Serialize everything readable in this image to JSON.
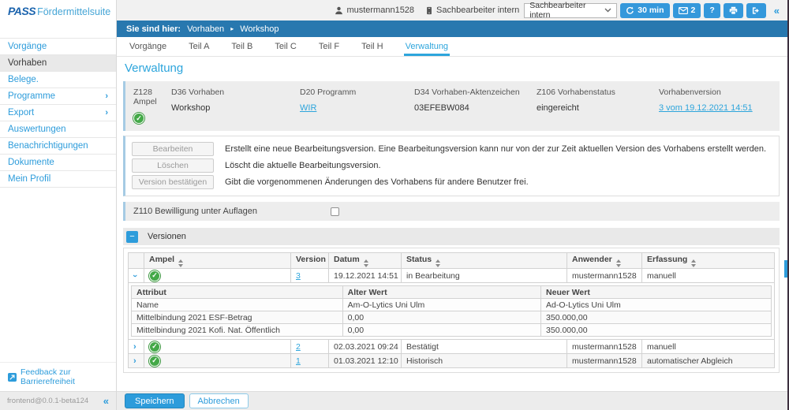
{
  "glyphs": {
    "check": "✓",
    "chevron_right": "›",
    "collapse_left": "«",
    "minus": "−",
    "breadcrumb_arrow": "▸"
  },
  "brand": {
    "bold": "PASS",
    "rest": "Fördermittelsuite"
  },
  "topbar": {
    "username": "mustermann1528",
    "role": "Sachbearbeiter intern",
    "role_select": "Sachbearbeiter intern",
    "session": "30 min",
    "mail_count": "2",
    "help": "?"
  },
  "sidebar": {
    "items": [
      {
        "label": "Vorgänge"
      },
      {
        "label": "Vorhaben"
      },
      {
        "label": "Belege."
      },
      {
        "label": "Programme"
      },
      {
        "label": "Export"
      },
      {
        "label": "Auswertungen"
      },
      {
        "label": "Benachrichtigungen"
      },
      {
        "label": "Dokumente"
      },
      {
        "label": "Mein Profil"
      }
    ],
    "feedback": "Feedback zur Barrierefreiheit",
    "build": "frontend@0.0.1-beta124"
  },
  "breadcrumb": {
    "prefix": "Sie sind hier:",
    "level1": "Vorhaben",
    "level2": "Workshop"
  },
  "tabs": {
    "items": [
      "Vorgänge",
      "Teil A",
      "Teil B",
      "Teil C",
      "Teil F",
      "Teil H",
      "Verwaltung"
    ]
  },
  "page": {
    "title": "Verwaltung"
  },
  "summary": {
    "fields": [
      {
        "label": "Z128 Ampel",
        "value": ""
      },
      {
        "label": "D36 Vorhaben",
        "value": "Workshop"
      },
      {
        "label": "D20 Programm",
        "value": "WIR"
      },
      {
        "label": "D34 Vorhaben-Aktenzeichen",
        "value": "03EFEBW084"
      },
      {
        "label": "Z106 Vorhabenstatus",
        "value": "eingereicht"
      },
      {
        "label": "Vorhabenversion",
        "value": "3 vom 19.12.2021 14:51"
      }
    ]
  },
  "actions": {
    "rows": [
      {
        "button": "Bearbeiten",
        "description": "Erstellt eine neue Bearbeitungsversion. Eine Bearbeitungsversion kann nur von der zur Zeit aktuellen Version des Vorhabens erstellt werden."
      },
      {
        "button": "Löschen",
        "description": "Löscht die aktuelle Bearbeitungsversion."
      },
      {
        "button": "Version bestätigen",
        "description": "Gibt die vorgenommenen Änderungen des Vorhabens für andere Benutzer frei."
      }
    ]
  },
  "approval": {
    "label": "Z110 Bewilligung unter Auflagen",
    "checked": false
  },
  "versions": {
    "title": "Versionen",
    "columns": {
      "ampel": "Ampel",
      "version": "Version",
      "datum": "Datum",
      "status": "Status",
      "anwender": "Anwender",
      "erfassung": "Erfassung"
    },
    "rows": [
      {
        "version": "3",
        "datum": "19.12.2021 14:51",
        "status": "in Bearbeitung",
        "anwender": "mustermann1528",
        "erfassung": "manuell"
      },
      {
        "version": "2",
        "datum": "02.03.2021 09:24",
        "status": "Bestätigt",
        "anwender": "mustermann1528",
        "erfassung": "manuell"
      },
      {
        "version": "1",
        "datum": "01.03.2021 12:10",
        "status": "Historisch",
        "anwender": "mustermann1528",
        "erfassung": "automatischer Abgleich"
      }
    ],
    "detail": {
      "columns": {
        "attribut": "Attribut",
        "alter": "Alter Wert",
        "neuer": "Neuer Wert"
      },
      "rows": [
        {
          "attribut": "Name",
          "alter": "Am-O-Lytics Uni Ulm",
          "neuer": "Ad-O-Lytics Uni Ulm"
        },
        {
          "attribut": "Mittelbindung 2021 ESF-Betrag",
          "alter": "0,00",
          "neuer": "350.000,00"
        },
        {
          "attribut": "Mittelbindung 2021 Kofi. Nat. Öffentlich",
          "alter": "0,00",
          "neuer": "350.000,00"
        }
      ]
    }
  },
  "footer": {
    "save": "Speichern",
    "cancel": "Abbrechen"
  }
}
